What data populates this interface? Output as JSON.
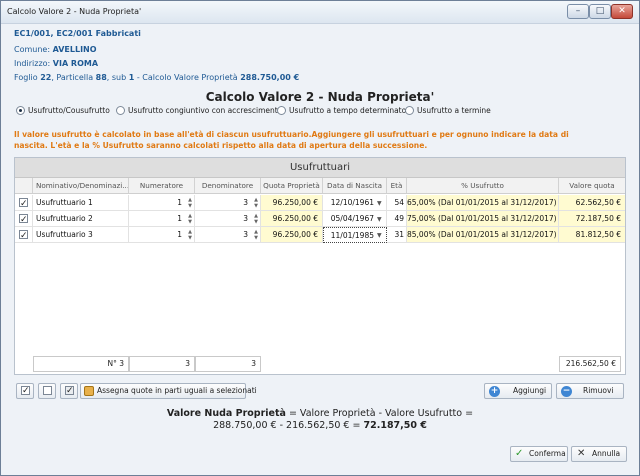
{
  "window": {
    "title": "Calcolo Valore 2 - Nuda Proprieta'",
    "min_symbol": "–",
    "max_symbol": "□",
    "close_symbol": "✕"
  },
  "info": {
    "line1": "EC1/001, EC2/001 Fabbricati",
    "comune_label": "Comune:",
    "comune_value": "AVELLINO",
    "indirizzo_label": "Indirizzo:",
    "indirizzo_value": "VIA ROMA",
    "foglio_prefix": "Foglio",
    "foglio_value": "22",
    "particella_prefix": ", Particella",
    "particella_value": "88",
    "sub_prefix": ", sub",
    "sub_value": "1",
    "calcolo_text": "- Calcolo Valore Proprietà",
    "valore_proprieta": "288.750,00 €"
  },
  "main_title": "Calcolo Valore 2 - Nuda Proprieta'",
  "radios": [
    {
      "label": "Usufrutto/Cousufrutto",
      "checked": true
    },
    {
      "label": "Usufrutto congiuntivo con accrescimento",
      "checked": false
    },
    {
      "label": "Usufrutto a tempo determinato",
      "checked": false
    },
    {
      "label": "Usufrutto a termine",
      "checked": false
    }
  ],
  "warning": {
    "line1": "Il valore usufrutto è calcolato in base all'età di ciascun usufruttuario.Aggiungere gli usufruttuari e per ognuno indicare la data di",
    "line2": "nascita. L'età e la % Usufrutto saranno calcolati rispetto alla data di apertura della successione."
  },
  "grid": {
    "title": "Usufruttuari",
    "headers": [
      "Nominativo/Denominazi...",
      "Numeratore",
      "Denominatore",
      "Quota Proprietà",
      "Data di Nascita",
      "Età",
      "% Usufrutto",
      "Valore quota"
    ],
    "rows": [
      {
        "checked": true,
        "name": "Usufruttuario 1",
        "num": "1",
        "den": "3",
        "quota": "96.250,00 €",
        "nascita": "12/10/1961",
        "eta": "54",
        "perc": "65,00% (Dal 01/01/2015 al 31/12/2017)",
        "valore": "62.562,50 €"
      },
      {
        "checked": true,
        "name": "Usufruttuario 2",
        "num": "1",
        "den": "3",
        "quota": "96.250,00 €",
        "nascita": "05/04/1967",
        "eta": "49",
        "perc": "75,00% (Dal 01/01/2015 al 31/12/2017)",
        "valore": "72.187,50 €"
      },
      {
        "checked": true,
        "name": "Usufruttuario 3",
        "num": "1",
        "den": "3",
        "quota": "96.250,00 €",
        "nascita": "11/01/1985",
        "eta": "31",
        "perc": "85,00% (Dal 01/01/2015 al 31/12/2017)",
        "valore": "81.812,50 €"
      }
    ],
    "footer": {
      "count": "N° 3",
      "num_total": "3",
      "den_total": "3",
      "valore_total": "216.562,50 €"
    }
  },
  "toolbar": {
    "assegna_label": "Assegna quote in parti uguali a selezionati",
    "aggiungi_label": "Aggiungi",
    "rimuovi_label": "Rimuovi"
  },
  "summary": {
    "label": "Valore Nuda Proprietà",
    "formula": "= Valore Proprietà - Valore Usufrutto =",
    "calc": "288.750,00 € - 216.562,50 € =",
    "result": "72.187,50 €"
  },
  "buttons": {
    "conferma": "Conferma",
    "annulla": "Annulla"
  },
  "colors": {
    "accent_blue": "#1f5a94",
    "warning_orange": "#e07a14",
    "yellow_cell": "#fffbd1"
  }
}
